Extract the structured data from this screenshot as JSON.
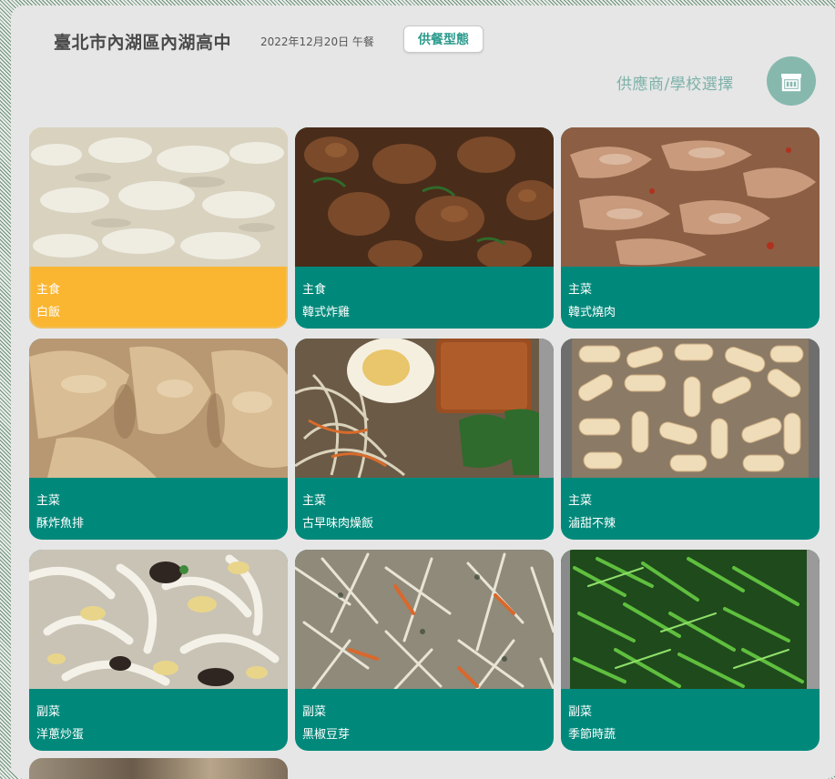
{
  "header": {
    "school": "臺北市內湖區內湖高中",
    "date": "2022年12月20日 午餐",
    "service_button": "供餐型態"
  },
  "supplier": {
    "label": "供應商/學校選擇",
    "icon": "store-icon"
  },
  "dishes": [
    {
      "category": "主食",
      "name": "白飯",
      "selected": true
    },
    {
      "category": "主食",
      "name": "韓式炸雞"
    },
    {
      "category": "主菜",
      "name": "韓式燒肉"
    },
    {
      "category": "主菜",
      "name": "酥炸魚排"
    },
    {
      "category": "主菜",
      "name": "古早味肉燥飯"
    },
    {
      "category": "主菜",
      "name": "滷甜不辣"
    },
    {
      "category": "副菜",
      "name": "洋蔥炒蛋"
    },
    {
      "category": "副菜",
      "name": "黑椒豆芽"
    },
    {
      "category": "副菜",
      "name": "季節時蔬"
    }
  ],
  "colors": {
    "card": "#00897b",
    "selected": "#fbb631",
    "accent": "#2a9a8c",
    "icon_bg": "#86b8ae"
  }
}
